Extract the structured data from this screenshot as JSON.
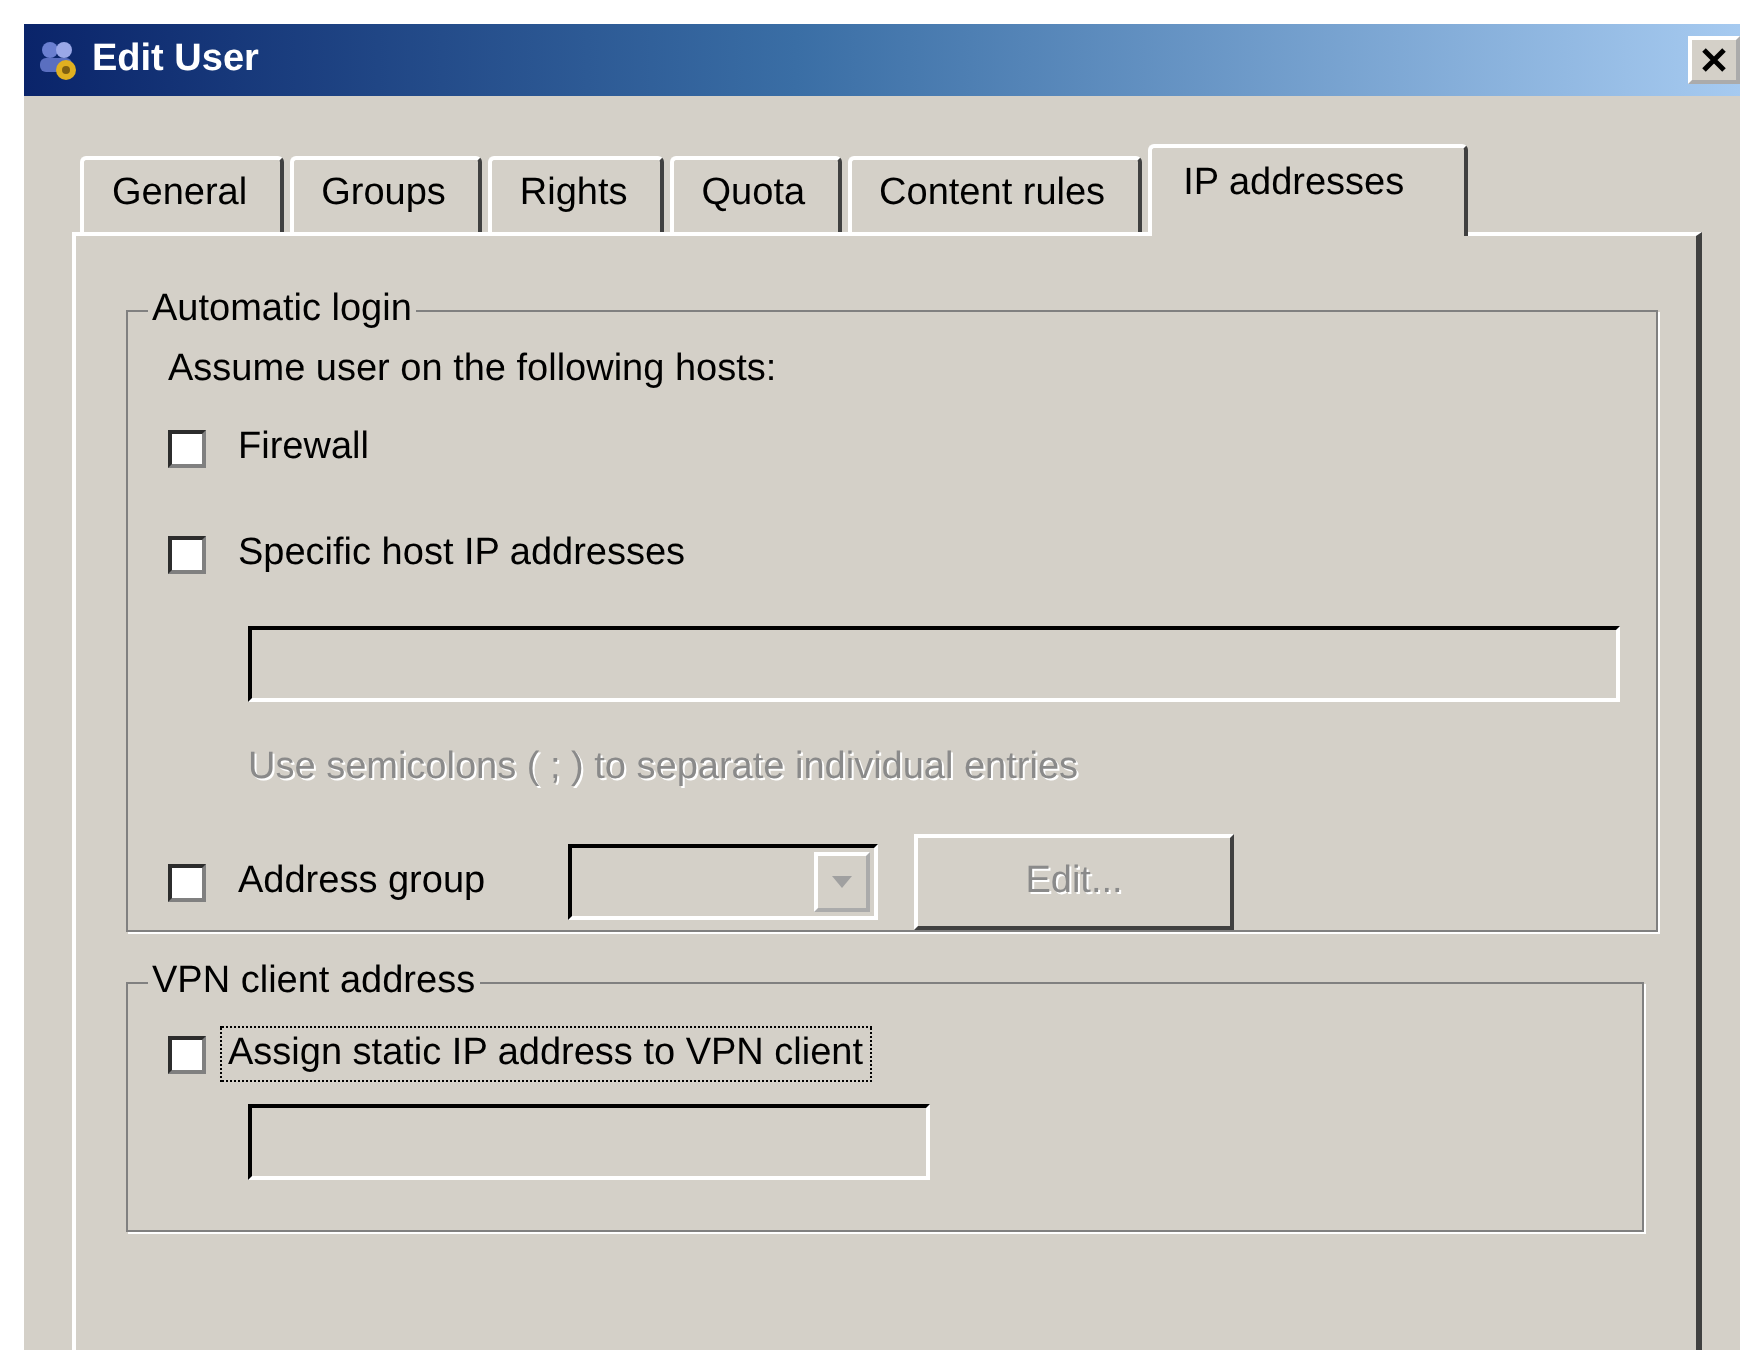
{
  "window": {
    "title": "Edit User"
  },
  "tabs": [
    {
      "label": "General",
      "selected": false
    },
    {
      "label": "Groups",
      "selected": false
    },
    {
      "label": "Rights",
      "selected": false
    },
    {
      "label": "Quota",
      "selected": false
    },
    {
      "label": "Content rules",
      "selected": false
    },
    {
      "label": "IP addresses",
      "selected": true
    }
  ],
  "automatic_login": {
    "title": "Automatic login",
    "prompt": "Assume user on the following hosts:",
    "firewall": {
      "label": "Firewall",
      "checked": false
    },
    "specific_hosts": {
      "label": "Specific host IP addresses",
      "checked": false,
      "field_disabled": true,
      "hint": "Use semicolons ( ; ) to separate individual entries",
      "hint_disabled": true
    },
    "address_group": {
      "label": "Address group",
      "checked": false,
      "combo_disabled": true,
      "edit_button": "Edit...",
      "edit_disabled": true
    }
  },
  "vpn": {
    "title": "VPN client address",
    "assign": {
      "label": "Assign static IP address to VPN client",
      "checked": false,
      "focused": true
    },
    "field_disabled": true
  }
}
